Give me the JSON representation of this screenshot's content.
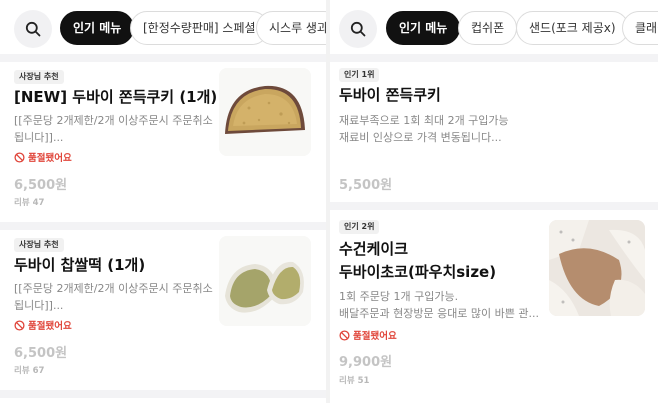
{
  "left": {
    "tabs": [
      "인기 메뉴",
      "[한정수량판매] 스페셜",
      "시스루 생과"
    ],
    "items": [
      {
        "badge": "사장님 추천",
        "title": "[NEW] 두바이 쫀득쿠키 (1개)",
        "desc_line1": "[[주문당 2개제한/2개 이상주문시 주문취소",
        "desc_line2": "됩니다]]...",
        "status": "품절됐어요",
        "price": "6,500원",
        "review": "리뷰 47"
      },
      {
        "badge": "사장님 추천",
        "title": "두바이 찹쌀떡 (1개)",
        "desc_line1": "[[주문당 2개제한/2개 이상주문시 주문취소",
        "desc_line2": "됩니다]]...",
        "status": "품절됐어요",
        "price": "6,500원",
        "review": "리뷰 67"
      }
    ]
  },
  "right": {
    "tabs": [
      "인기 메뉴",
      "컵쉬폰",
      "샌드(포크 제공x)",
      "클래식"
    ],
    "items": [
      {
        "badge": "인기 1위",
        "title": "두바이 쫀득쿠키",
        "desc_line1": "재료부족으로 1회 최대 2개 구입가능",
        "desc_line2": "재료비 인상으로 가격 변동됩니다...",
        "price": "5,500원"
      },
      {
        "badge": "인기 2위",
        "title_line1": "수건케이크",
        "title_line2": "두바이초코(파우치size)",
        "desc_line1": "1회 주문당 1개 구입가능.",
        "desc_line2": "배달주문과 현장방문 응대로 많이 바쁜 관...",
        "status": "품절됐어요",
        "price": "9,900원",
        "review": "리뷰 51"
      }
    ]
  },
  "icons": {
    "search": "search-icon",
    "soldout": "prohibited-icon"
  },
  "colors": {
    "active_tab": "#111111",
    "soldout": "#e0453a",
    "price_muted": "#c4c4c4"
  }
}
